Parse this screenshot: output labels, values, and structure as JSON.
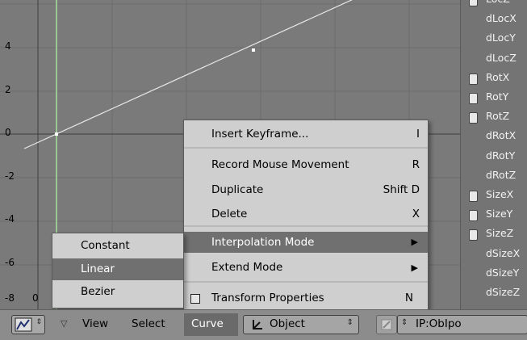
{
  "graph": {
    "y_ticks": [
      "4",
      "2",
      "0",
      "-2",
      "-4",
      "-6",
      "-8"
    ],
    "x_ticks": [
      "0"
    ]
  },
  "channels": [
    {
      "label": "LocZ",
      "checkbox": true
    },
    {
      "label": "dLocX",
      "checkbox": false
    },
    {
      "label": "dLocY",
      "checkbox": false
    },
    {
      "label": "dLocZ",
      "checkbox": false
    },
    {
      "label": "RotX",
      "checkbox": true
    },
    {
      "label": "RotY",
      "checkbox": true
    },
    {
      "label": "RotZ",
      "checkbox": true
    },
    {
      "label": "dRotX",
      "checkbox": false
    },
    {
      "label": "dRotY",
      "checkbox": false
    },
    {
      "label": "dRotZ",
      "checkbox": false
    },
    {
      "label": "SizeX",
      "checkbox": true
    },
    {
      "label": "SizeY",
      "checkbox": true
    },
    {
      "label": "SizeZ",
      "checkbox": true
    },
    {
      "label": "dSizeX",
      "checkbox": false
    },
    {
      "label": "dSizeY",
      "checkbox": false
    },
    {
      "label": "dSizeZ",
      "checkbox": false
    }
  ],
  "curve_menu": {
    "insert_keyframe": {
      "label": "Insert Keyframe...",
      "shortcut": "I"
    },
    "record_mouse": {
      "label": "Record Mouse Movement",
      "shortcut": "R"
    },
    "duplicate": {
      "label": "Duplicate",
      "shortcut": "Shift D"
    },
    "delete": {
      "label": "Delete",
      "shortcut": "X"
    },
    "interpolation": {
      "label": "Interpolation Mode",
      "arrow": "▶"
    },
    "extend": {
      "label": "Extend Mode",
      "arrow": "▶"
    },
    "transform": {
      "label": "Transform Properties",
      "shortcut": "N"
    }
  },
  "interp_menu": {
    "constant": "Constant",
    "linear": "Linear",
    "bezier": "Bezier"
  },
  "header": {
    "view": "View",
    "select": "Select",
    "curve": "Curve",
    "object": "Object",
    "ipo_name": "IP:ObIpo"
  }
}
